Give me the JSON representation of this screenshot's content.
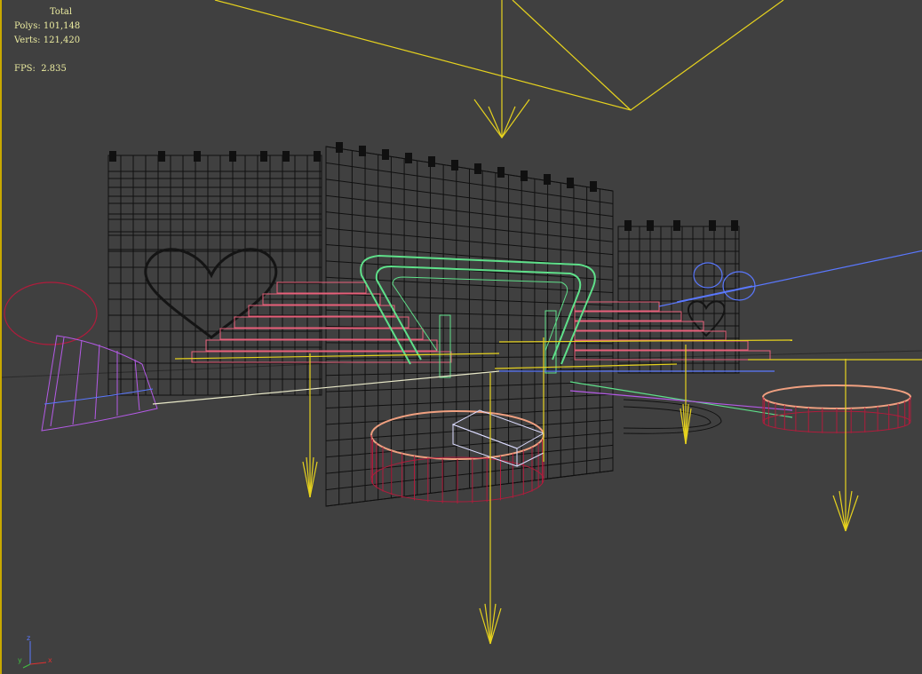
{
  "stats": {
    "total_label": "Total",
    "polys_label": "Polys:",
    "polys_value": "101,148",
    "verts_label": "Verts:",
    "verts_value": "121,420",
    "fps_label": "FPS:",
    "fps_value": "2.835"
  },
  "axis_gizmo": {
    "z_label": "z",
    "y_label": "y",
    "x_label": "x"
  },
  "colors": {
    "background": "#404040",
    "viewport_border": "#c8a800",
    "stats_text": "#ececa0",
    "light_yellow": "#e6d21e",
    "wire_black": "#101010",
    "wire_green": "#5fe08a",
    "wire_pink": "#e8607a",
    "wire_red": "#b01c3c",
    "wire_purple": "#b45ae6",
    "wire_blue": "#5a78ff",
    "wire_salmon": "#f0a080"
  },
  "scene_objects": [
    "stage-backdrop-left",
    "stage-backdrop-center",
    "stage-backdrop-right",
    "heart-shape",
    "arch-truss",
    "stairs-left",
    "stairs-right",
    "round-platform-center",
    "round-platform-right",
    "purple-cone-left",
    "red-circle-left",
    "blue-spotlight",
    "spotlight-arrows"
  ]
}
